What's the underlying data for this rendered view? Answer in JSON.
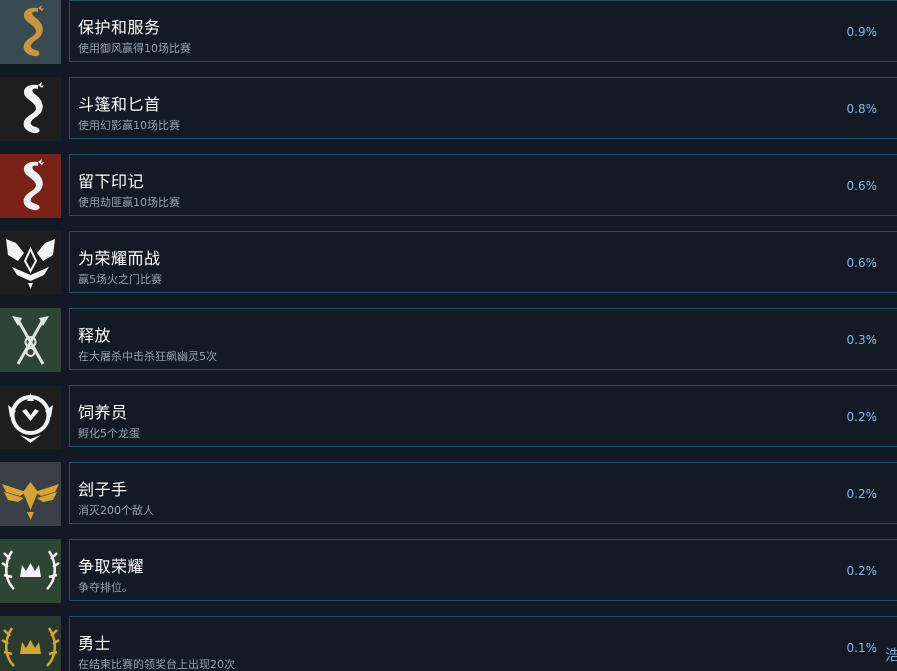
{
  "achievements": [
    {
      "title": "保护和服务",
      "description": "使用御风赢得10场比赛",
      "percent": "0.9%",
      "icon": "gold-dragon-icon",
      "icon_bg": "#3a4a52",
      "icon_fg": "#c9963a"
    },
    {
      "title": "斗篷和匕首",
      "description": "使用幻影赢10场比赛",
      "percent": "0.8%",
      "icon": "white-dragon-icon",
      "icon_bg": "#1e1e1e",
      "icon_fg": "#f2f2f2"
    },
    {
      "title": "留下印记",
      "description": "使用劫匪赢10场比赛",
      "percent": "0.6%",
      "icon": "red-dragon-icon",
      "icon_bg": "#7a2216",
      "icon_fg": "#f2f2f2"
    },
    {
      "title": "为荣耀而战",
      "description": "赢5场火之门比赛",
      "percent": "0.6%",
      "icon": "wolves-crest-icon",
      "icon_bg": "#1e1e1e",
      "icon_fg": "#f2f2f2"
    },
    {
      "title": "释放",
      "description": "在大屠杀中击杀狂飙幽灵5次",
      "percent": "0.3%",
      "icon": "crossed-axes-icon",
      "icon_bg": "#2e4436",
      "icon_fg": "#dfe6df"
    },
    {
      "title": "饲养员",
      "description": "孵化5个龙蛋",
      "percent": "0.2%",
      "icon": "dragon-emblem-icon",
      "icon_bg": "#1e1e1e",
      "icon_fg": "#f2f2f2"
    },
    {
      "title": "刽子手",
      "description": "消灭200个敌人",
      "percent": "0.2%",
      "icon": "winged-crest-icon",
      "icon_bg": "#3a4046",
      "icon_fg": "#d6a431"
    },
    {
      "title": "争取荣耀",
      "description": "争夺排位。",
      "percent": "0.2%",
      "icon": "antler-crown-icon",
      "icon_bg": "#2f4533",
      "icon_fg": "#f2f2f2"
    },
    {
      "title": "勇士",
      "description": "在结束比赛的领奖台上出现20次",
      "percent": "0.1%",
      "icon": "gold-antler-crown-icon",
      "icon_bg": "#2a3a2e",
      "icon_fg": "#d6a431"
    }
  ],
  "overflow_text": "浩"
}
